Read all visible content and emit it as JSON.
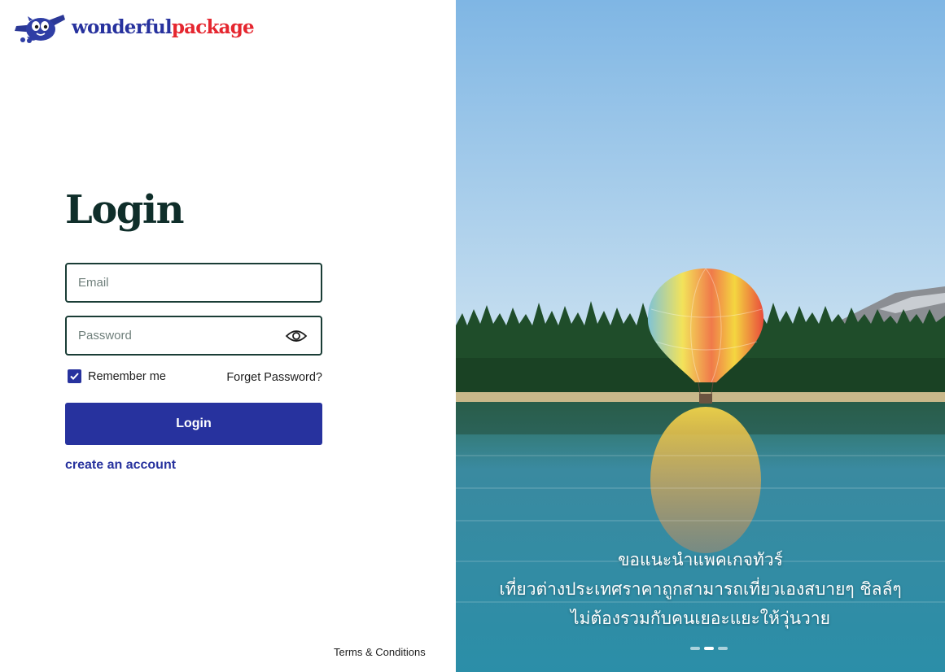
{
  "brand": {
    "name_part1": "wonderful",
    "name_part2": "package"
  },
  "login": {
    "title": "Login",
    "email_placeholder": "Email",
    "password_placeholder": "Password",
    "remember_label": "Remember me",
    "remember_checked": true,
    "forgot_label": "Forget Password?",
    "submit_label": "Login",
    "create_account_label": "create an account"
  },
  "footer": {
    "terms_label": "Terms & Conditions"
  },
  "hero": {
    "caption_lines": [
      "ขอแนะนำแพคเกจทัวร์",
      "เที่ยวต่างประเทศราคาถูกสามารถเที่ยวเองสบายๆ ชิลล์ๆ",
      "ไม่ต้องรวมกับคนเยอะแยะให้วุ่นวาย"
    ],
    "slide_count": 3,
    "active_slide": 2
  },
  "colors": {
    "primary": "#27329e",
    "accent": "#e5262f",
    "title": "#0f2e2a",
    "field_border": "#1a3d36"
  }
}
